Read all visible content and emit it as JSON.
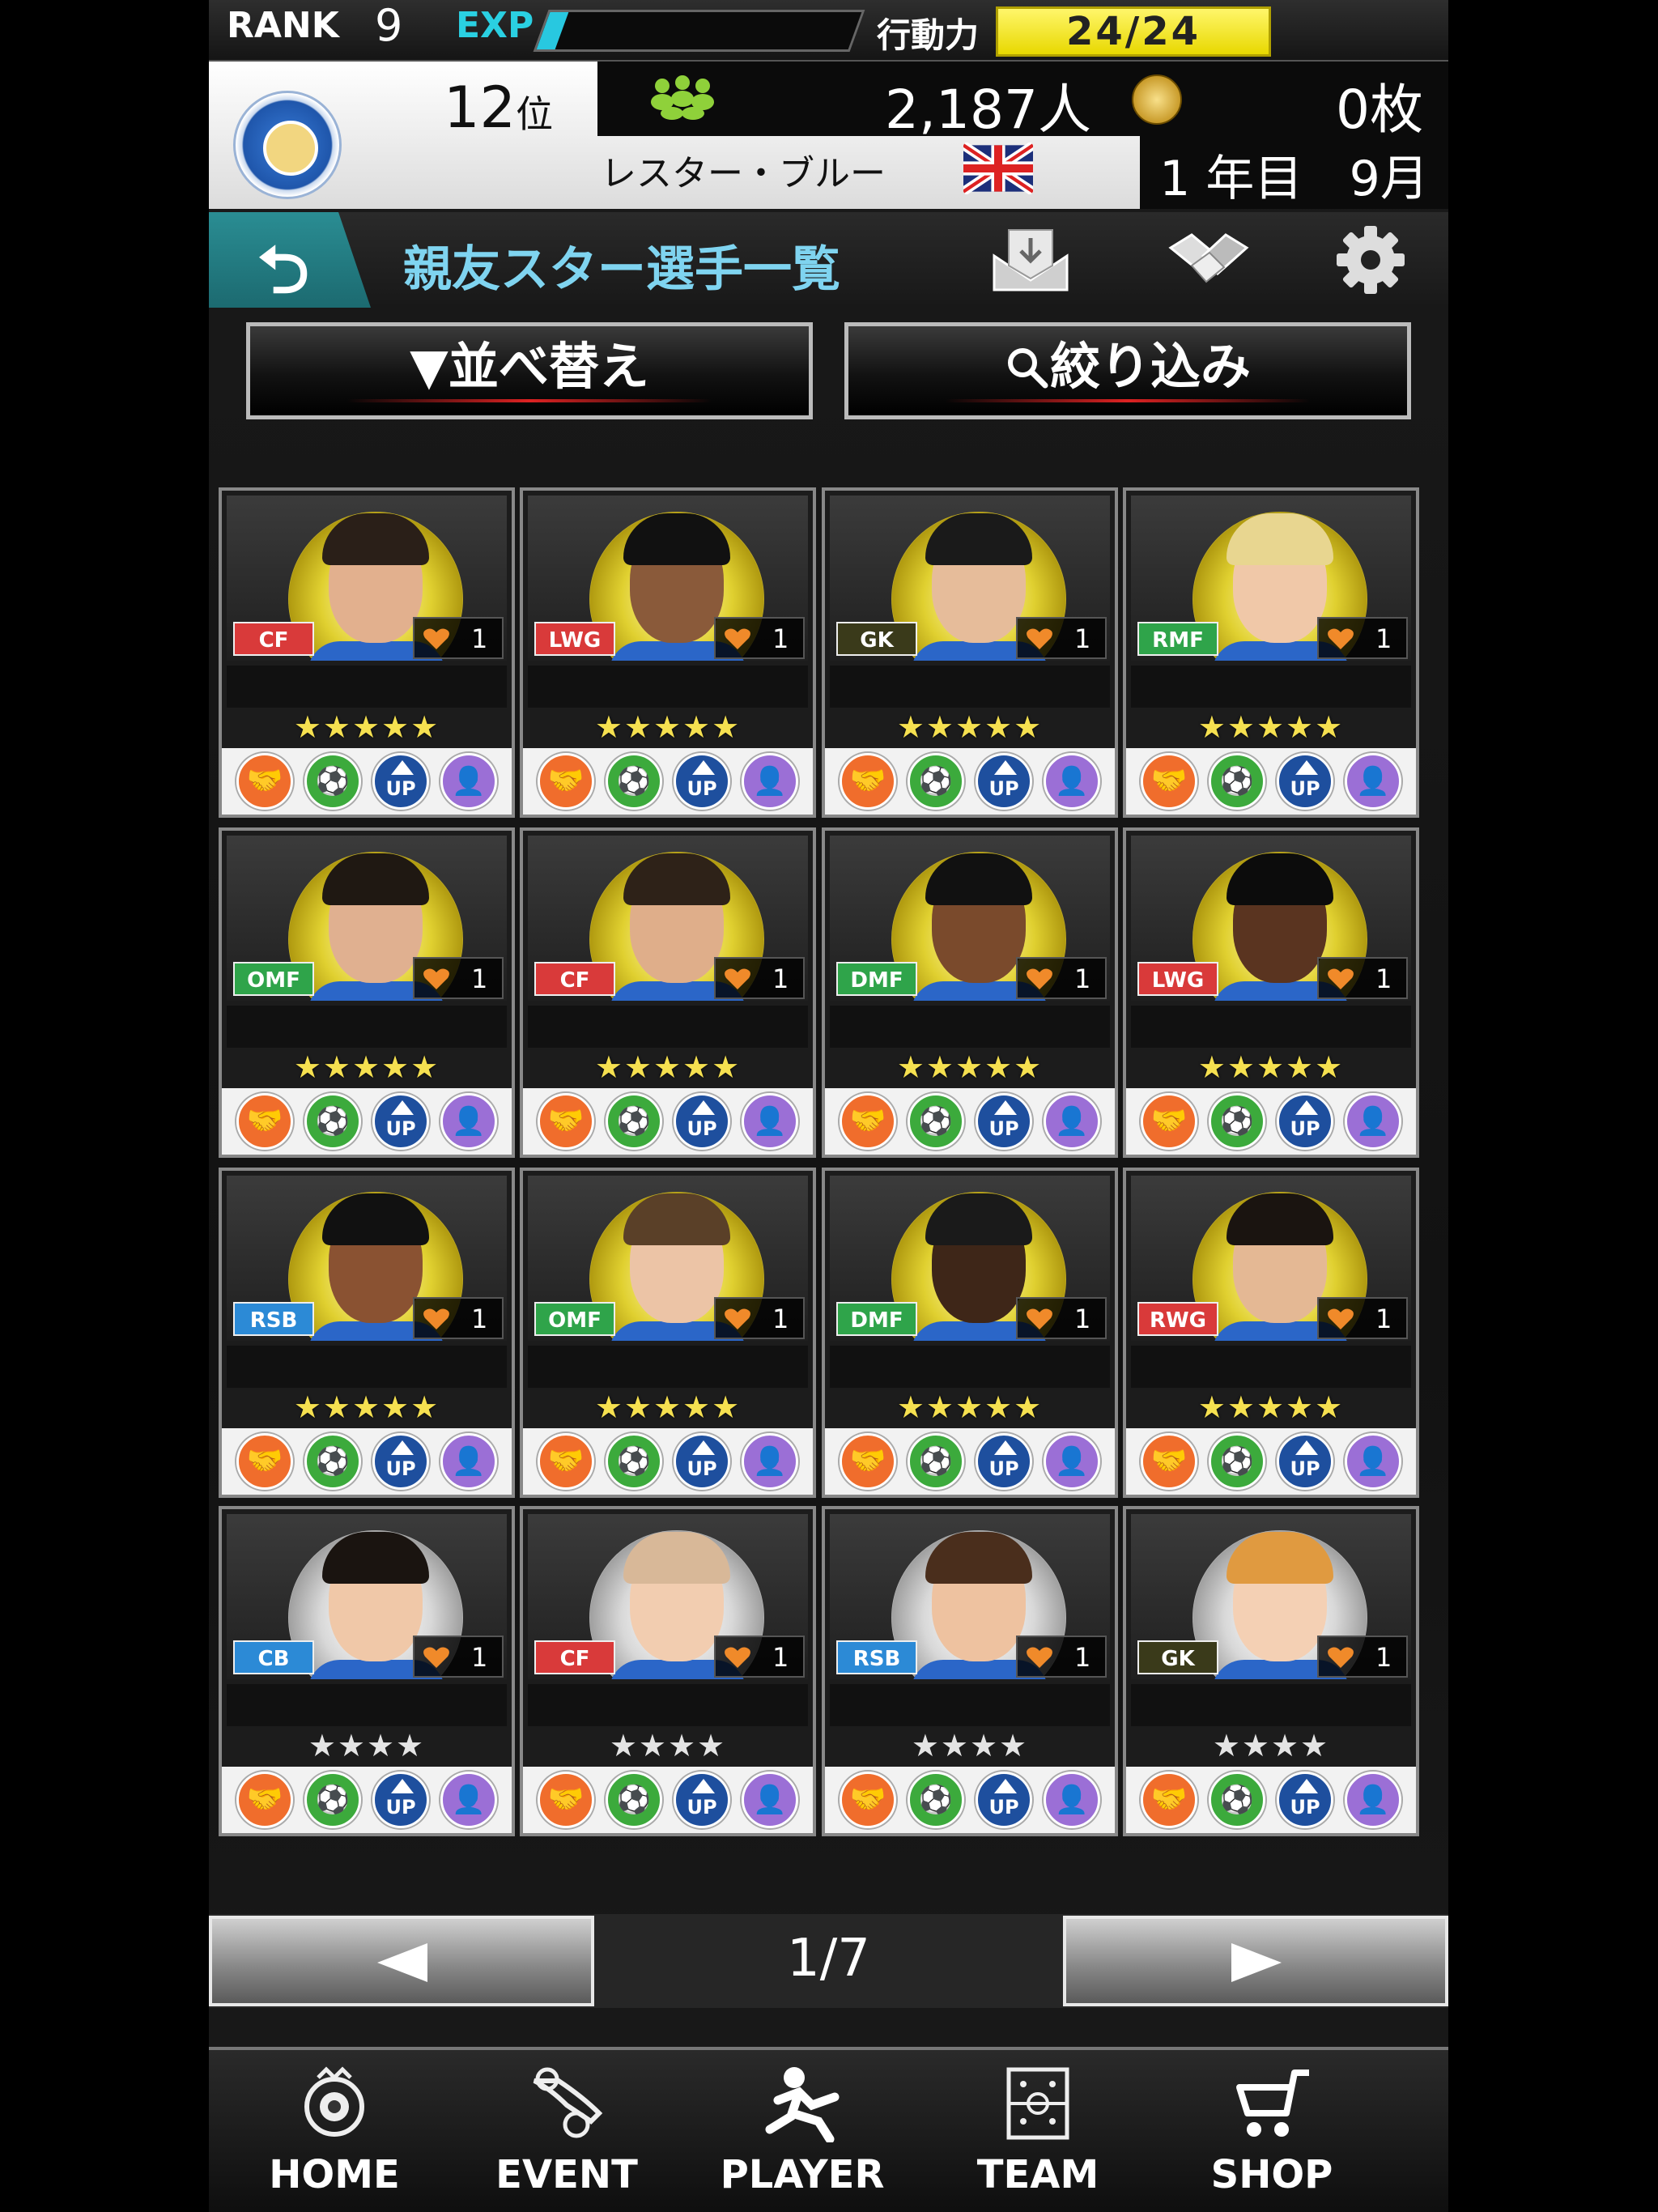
{
  "top_bar": {
    "rank_label": "RANK",
    "rank_value": "9",
    "exp_label": "EXP",
    "exp_progress": 0.06,
    "action_label": "行動力",
    "action_value": "24/24"
  },
  "club": {
    "position_number": "12",
    "position_suffix": "位",
    "fans_value": "2,187人",
    "coins_value": "0枚",
    "name": "レスター・ブルー",
    "season_year": "1 年目",
    "season_month": "9月"
  },
  "title_bar": {
    "back_glyph": "⮌",
    "title": "親友スター選手一覧"
  },
  "controls": {
    "sort_label": "▼並べ替え",
    "filter_label": "絞り込み"
  },
  "players": [
    {
      "position": "CF",
      "pos_color": "#d93a3a",
      "level": "1",
      "medal": "gold",
      "stars": "★★★★★",
      "skin": "#e2b08e",
      "hair": "#2a1f18"
    },
    {
      "position": "LWG",
      "pos_color": "#d93a3a",
      "level": "1",
      "medal": "gold",
      "stars": "★★★★★",
      "skin": "#8a5a3a",
      "hair": "#111111"
    },
    {
      "position": "GK",
      "pos_color": "#3a3a1a",
      "level": "1",
      "medal": "gold",
      "stars": "★★★★★",
      "skin": "#e6bc9a",
      "hair": "#1a1a1a"
    },
    {
      "position": "RMF",
      "pos_color": "#2fa44a",
      "level": "1",
      "medal": "gold",
      "stars": "★★★★★",
      "skin": "#f0c8a8",
      "hair": "#e8d690"
    },
    {
      "position": "OMF",
      "pos_color": "#2fa44a",
      "level": "1",
      "medal": "gold",
      "stars": "★★★★★",
      "skin": "#e0b090",
      "hair": "#1f1812"
    },
    {
      "position": "CF",
      "pos_color": "#d93a3a",
      "level": "1",
      "medal": "gold",
      "stars": "★★★★★",
      "skin": "#dfae8a",
      "hair": "#2e2218"
    },
    {
      "position": "DMF",
      "pos_color": "#2fa44a",
      "level": "1",
      "medal": "gold",
      "stars": "★★★★★",
      "skin": "#7a4a2c",
      "hair": "#111111"
    },
    {
      "position": "LWG",
      "pos_color": "#d93a3a",
      "level": "1",
      "medal": "gold",
      "stars": "★★★★★",
      "skin": "#5a3420",
      "hair": "#0c0c0c"
    },
    {
      "position": "RSB",
      "pos_color": "#2c8ad6",
      "level": "1",
      "medal": "gold",
      "stars": "★★★★★",
      "skin": "#8a5232",
      "hair": "#111111"
    },
    {
      "position": "OMF",
      "pos_color": "#2fa44a",
      "level": "1",
      "medal": "gold",
      "stars": "★★★★★",
      "skin": "#ecc4a6",
      "hair": "#5a4028"
    },
    {
      "position": "DMF",
      "pos_color": "#2fa44a",
      "level": "1",
      "medal": "gold",
      "stars": "★★★★★",
      "skin": "#3e2618",
      "hair": "#1a1a1a"
    },
    {
      "position": "RWG",
      "pos_color": "#d93a3a",
      "level": "1",
      "medal": "gold",
      "stars": "★★★★★",
      "skin": "#e4b894",
      "hair": "#1a1410"
    },
    {
      "position": "CB",
      "pos_color": "#2c8ad6",
      "level": "1",
      "medal": "silver",
      "stars": "★★★★",
      "skin": "#f0c8a8",
      "hair": "#1a1410"
    },
    {
      "position": "CF",
      "pos_color": "#d93a3a",
      "level": "1",
      "medal": "silver",
      "stars": "★★★★",
      "skin": "#f2cdb0",
      "hair": "#d8b898"
    },
    {
      "position": "RSB",
      "pos_color": "#2c8ad6",
      "level": "1",
      "medal": "silver",
      "stars": "★★★★",
      "skin": "#eec2a0",
      "hair": "#4a2e1c"
    },
    {
      "position": "GK",
      "pos_color": "#3a3a1a",
      "level": "1",
      "medal": "silver",
      "stars": "★★★★",
      "skin": "#f4d0b4",
      "hair": "#e09a40"
    }
  ],
  "card_icons": {
    "friend_glyph": "🤝",
    "train_glyph": "⚽",
    "up_label": "UP",
    "coach_glyph": "👤"
  },
  "pager": {
    "page_indicator": "1/7"
  },
  "nav": {
    "home": "HOME",
    "event": "EVENT",
    "player": "PLAYER",
    "team": "TEAM",
    "shop": "SHOP"
  },
  "colors": {
    "accent_teal": "#2a8d93",
    "exp_cyan": "#28c8e0",
    "action_yellow": "#f4e600",
    "title_blue": "#7fd4f0"
  }
}
